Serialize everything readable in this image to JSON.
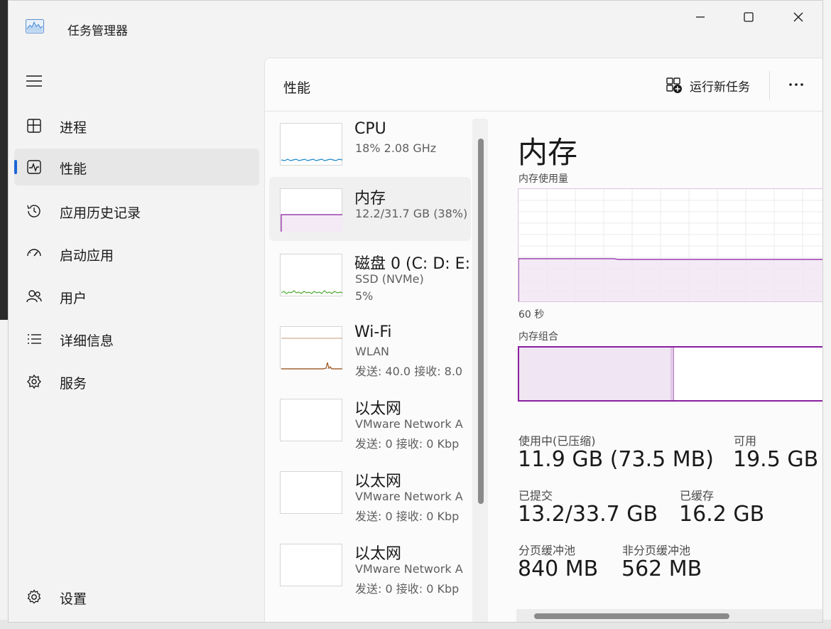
{
  "window": {
    "title": "任务管理器",
    "icon": "performance-chart-icon"
  },
  "sidebar": {
    "items": [
      {
        "label": "进程",
        "icon": "processes-icon"
      },
      {
        "label": "性能",
        "icon": "performance-icon",
        "active": true
      },
      {
        "label": "应用历史记录",
        "icon": "history-icon"
      },
      {
        "label": "启动应用",
        "icon": "startup-icon"
      },
      {
        "label": "用户",
        "icon": "users-icon"
      },
      {
        "label": "详细信息",
        "icon": "details-icon"
      },
      {
        "label": "服务",
        "icon": "services-icon"
      }
    ],
    "settings_label": "设置"
  },
  "header": {
    "title": "性能",
    "run_task_label": "运行新任务",
    "more_label": "..."
  },
  "devices": [
    {
      "name": "CPU",
      "line1": "18%  2.08 GHz",
      "line2": ""
    },
    {
      "name": "内存",
      "line1": "12.2/31.7 GB (38%)",
      "line2": ""
    },
    {
      "name": "磁盘 0 (C: D: E:",
      "line1": "SSD (NVMe)",
      "line2": "5%"
    },
    {
      "name": "Wi-Fi",
      "line1": "WLAN",
      "line2": "发送: 40.0  接收: 8.0"
    },
    {
      "name": "以太网",
      "line1": "VMware Network A",
      "line2": "发送: 0  接收: 0 Kbp"
    },
    {
      "name": "以太网",
      "line1": "VMware Network A",
      "line2": "发送: 0  接收: 0 Kbp"
    },
    {
      "name": "以太网",
      "line1": "VMware Network A",
      "line2": "发送: 0  接收: 0 Kbp"
    }
  ],
  "detail": {
    "title": "内存",
    "usage_label": "内存使用量",
    "time_label": "60 秒",
    "composition_label": "内存组合",
    "stats": {
      "in_use_label": "使用中(已压缩)",
      "in_use_value": "11.9 GB (73.5 MB)",
      "available_label": "可用",
      "available_value": "19.5 GB",
      "committed_label": "已提交",
      "committed_value": "13.2/33.7 GB",
      "cached_label": "已缓存",
      "cached_value": "16.2 GB",
      "paged_label": "分页缓冲池",
      "paged_value": "840 MB",
      "nonpaged_label": "非分页缓冲池",
      "nonpaged_value": "562 MB"
    }
  },
  "colors": {
    "accent": "#1f65d6",
    "memory": "#8a1fa0",
    "cpu": "#1a86c8",
    "disk": "#4ca832",
    "wifi": "#a0541a"
  }
}
